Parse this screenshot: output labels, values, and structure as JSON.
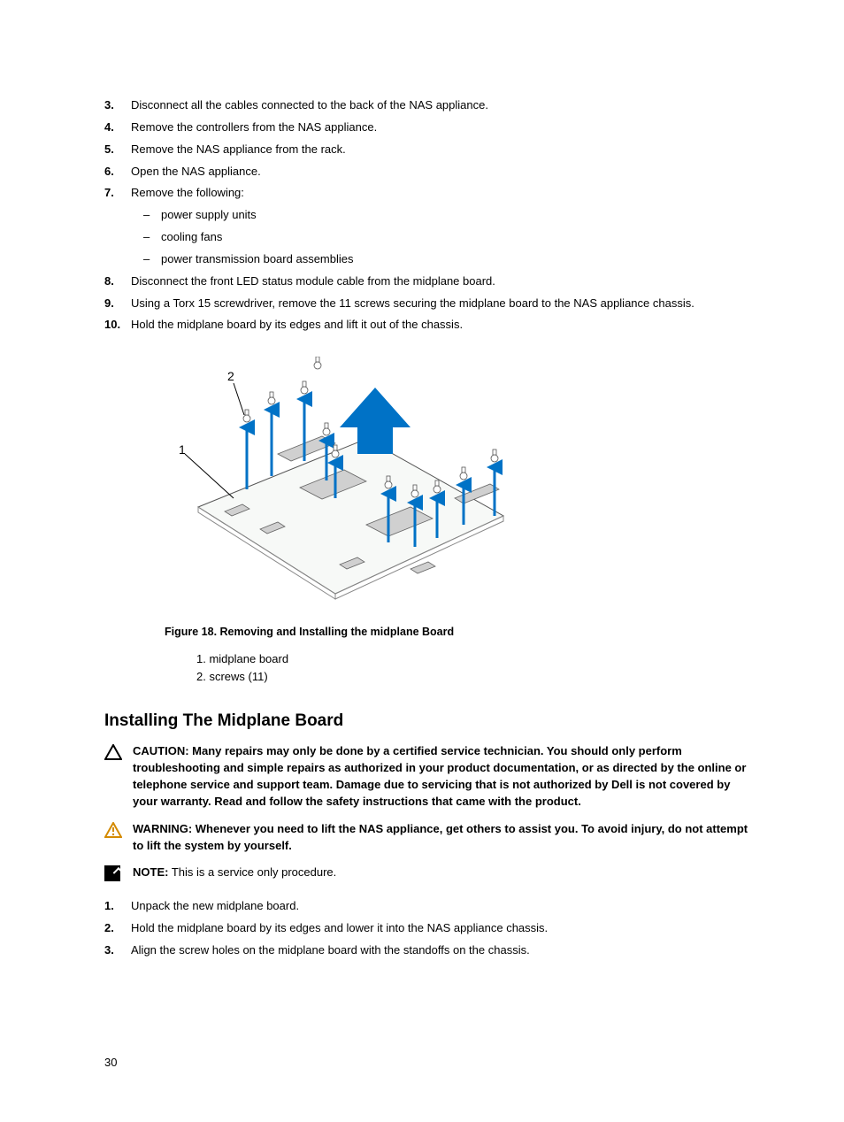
{
  "steps_top": [
    {
      "n": "3.",
      "t": "Disconnect all the cables connected to the back of the NAS appliance."
    },
    {
      "n": "4.",
      "t": "Remove the controllers from the NAS appliance."
    },
    {
      "n": "5.",
      "t": "Remove the NAS appliance from the rack."
    },
    {
      "n": "6.",
      "t": "Open the NAS appliance."
    },
    {
      "n": "7.",
      "t": "Remove the following:",
      "subs": [
        "power supply units",
        "cooling fans",
        "power transmission board assemblies"
      ]
    },
    {
      "n": "8.",
      "t": "Disconnect the front LED status module cable from the midplane board."
    },
    {
      "n": "9.",
      "t": "Using a Torx 15 screwdriver, remove the 11 screws securing the midplane board to the NAS appliance chassis."
    },
    {
      "n": "10.",
      "t": "Hold the midplane board by its edges and lift it out of the chassis."
    }
  ],
  "figure": {
    "callout1": "1",
    "callout2": "2",
    "caption": "Figure 18. Removing and Installing the midplane Board",
    "legend1": "1. midplane board",
    "legend2": "2. screws (11)"
  },
  "section_heading": "Installing The Midplane Board",
  "notices": {
    "caution_label": "CAUTION:",
    "caution_text": " Many repairs may only be done by a certified service technician. You should only perform troubleshooting and simple repairs as authorized in your product documentation, or as directed by the online or telephone service and support team. Damage due to servicing that is not authorized by Dell is not covered by your warranty. Read and follow the safety instructions that came with the product.",
    "warning_label": "WARNING:",
    "warning_text": " Whenever you need to lift the NAS appliance, get others to assist you. To avoid injury, do not attempt to lift the system by yourself.",
    "note_label": "NOTE:",
    "note_text": " This is a service only procedure."
  },
  "steps_bottom": [
    {
      "n": "1.",
      "t": "Unpack the new midplane board."
    },
    {
      "n": "2.",
      "t": "Hold the midplane board by its edges and lower it into the NAS appliance chassis."
    },
    {
      "n": "3.",
      "t": "Align the screw holes on the midplane board with the standoffs on the chassis."
    }
  ],
  "page_number": "30"
}
